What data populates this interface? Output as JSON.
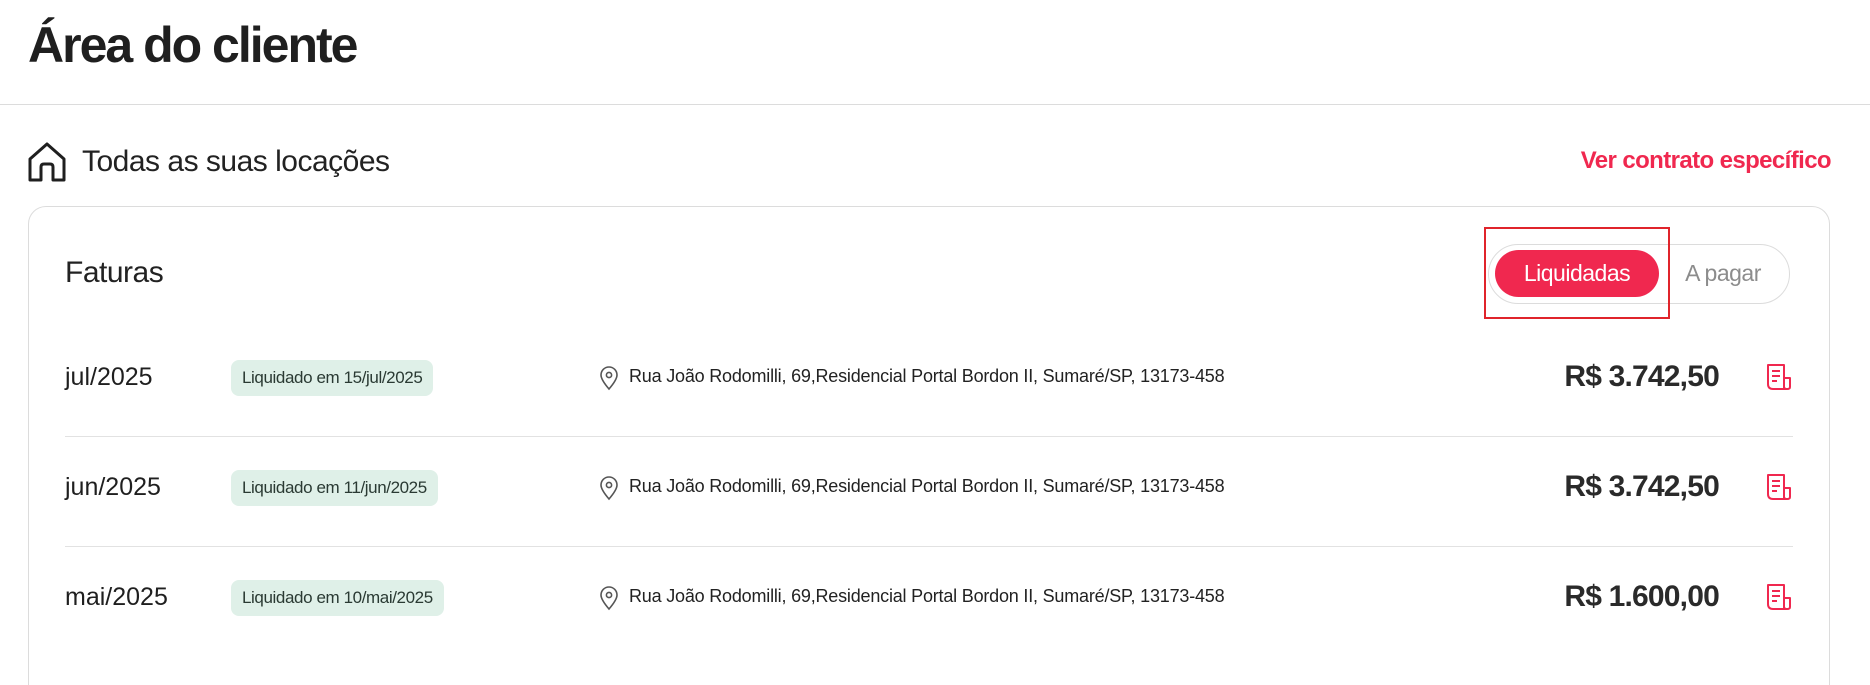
{
  "header": {
    "title": "Área do cliente"
  },
  "section": {
    "title": "Todas as suas locações",
    "contract_link": "Ver contrato específico",
    "icon": "home-icon"
  },
  "invoices": {
    "title": "Faturas",
    "toggle": {
      "paid_label": "Liquidadas",
      "due_label": "A pagar",
      "active": "Liquidadas"
    },
    "rows": [
      {
        "period": "jul/2025",
        "status": "Liquidado em 15/jul/2025",
        "address": "Rua João Rodomilli, 69,Residencial Portal Bordon II, Sumaré/SP, 13173-458",
        "amount": "R$ 3.742,50"
      },
      {
        "period": "jun/2025",
        "status": "Liquidado em 11/jun/2025",
        "address": "Rua João Rodomilli, 69,Residencial Portal Bordon II, Sumaré/SP, 13173-458",
        "amount": "R$ 3.742,50"
      },
      {
        "period": "mai/2025",
        "status": "Liquidado em 10/mai/2025",
        "address": "Rua João Rodomilli, 69,Residencial Portal Bordon II, Sumaré/SP, 13173-458",
        "amount": "R$ 1.600,00"
      }
    ]
  },
  "colors": {
    "accent": "#f0284f",
    "badge_bg": "#dff0e8",
    "highlight_box": "#e0242b",
    "border": "#dcdcdc"
  }
}
